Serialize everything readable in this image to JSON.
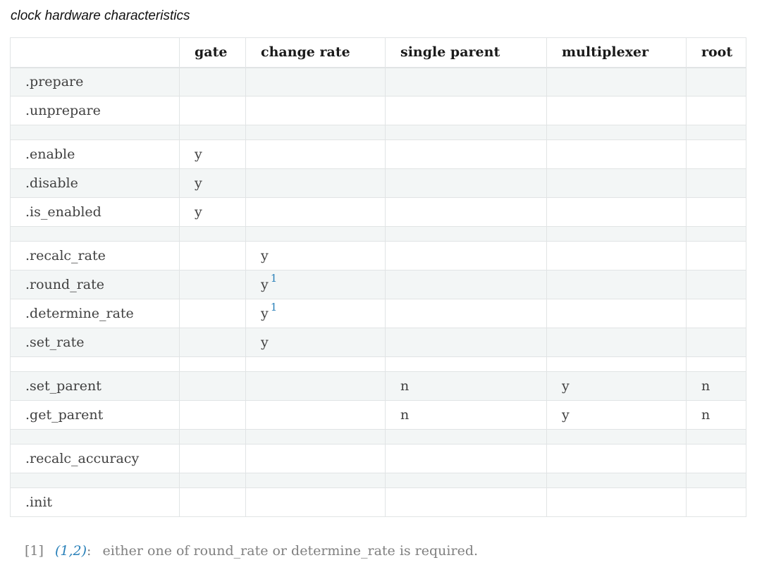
{
  "caption": "clock hardware characteristics",
  "table": {
    "headers": [
      "",
      "gate",
      "change rate",
      "single parent",
      "multiplexer",
      "root"
    ],
    "rows": [
      {
        "kind": "row",
        "cells": [
          ".prepare",
          "",
          "",
          "",
          "",
          ""
        ]
      },
      {
        "kind": "row",
        "cells": [
          ".unprepare",
          "",
          "",
          "",
          "",
          ""
        ]
      },
      {
        "kind": "spacer"
      },
      {
        "kind": "row",
        "cells": [
          ".enable",
          "y",
          "",
          "",
          "",
          ""
        ]
      },
      {
        "kind": "row",
        "cells": [
          ".disable",
          "y",
          "",
          "",
          "",
          ""
        ]
      },
      {
        "kind": "row",
        "cells": [
          ".is_enabled",
          "y",
          "",
          "",
          "",
          ""
        ]
      },
      {
        "kind": "spacer"
      },
      {
        "kind": "row",
        "cells": [
          ".recalc_rate",
          "",
          "y",
          "",
          "",
          ""
        ]
      },
      {
        "kind": "row",
        "cells": [
          ".round_rate",
          "",
          "y",
          "",
          "",
          ""
        ],
        "footnote_col": 2,
        "footnote_mark": "1"
      },
      {
        "kind": "row",
        "cells": [
          ".determine_rate",
          "",
          "y",
          "",
          "",
          ""
        ],
        "footnote_col": 2,
        "footnote_mark": "1"
      },
      {
        "kind": "row",
        "cells": [
          ".set_rate",
          "",
          "y",
          "",
          "",
          ""
        ]
      },
      {
        "kind": "spacer"
      },
      {
        "kind": "row",
        "cells": [
          ".set_parent",
          "",
          "",
          "n",
          "y",
          "n"
        ]
      },
      {
        "kind": "row",
        "cells": [
          ".get_parent",
          "",
          "",
          "n",
          "y",
          "n"
        ]
      },
      {
        "kind": "spacer"
      },
      {
        "kind": "row",
        "cells": [
          ".recalc_accuracy",
          "",
          "",
          "",
          "",
          ""
        ]
      },
      {
        "kind": "spacer"
      },
      {
        "kind": "row",
        "cells": [
          ".init",
          "",
          "",
          "",
          "",
          ""
        ]
      }
    ]
  },
  "footnote": {
    "label": "[1]",
    "backrefs": "(1,2)",
    "colon": ":",
    "text": "either one of round_rate or determine_rate is required."
  }
}
